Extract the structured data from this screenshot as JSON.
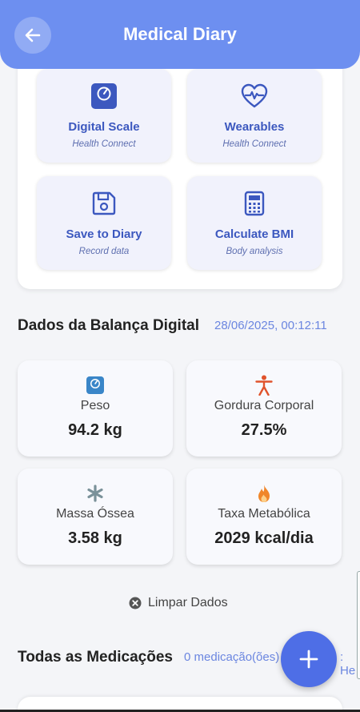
{
  "header": {
    "title": "Medical Diary"
  },
  "actions": [
    {
      "title": "Digital Scale",
      "subtitle": "Health Connect",
      "icon": "scale-icon"
    },
    {
      "title": "Wearables",
      "subtitle": "Health Connect",
      "icon": "heart-pulse-icon"
    },
    {
      "title": "Save to Diary",
      "subtitle": "Record data",
      "icon": "save-icon"
    },
    {
      "title": "Calculate BMI",
      "subtitle": "Body analysis",
      "icon": "calculator-icon"
    }
  ],
  "scale_section": {
    "title": "Dados da Balança Digital",
    "timestamp": "28/06/2025, 00:12:11"
  },
  "stats": [
    {
      "label": "Peso",
      "value": "94.2 kg",
      "icon": "scale-icon",
      "color": "#3a86c8"
    },
    {
      "label": "Gordura Corporal",
      "value": "27.5%",
      "icon": "body-icon",
      "color": "#e0532c"
    },
    {
      "label": "Massa Óssea",
      "value": "3.58 kg",
      "icon": "bone-icon",
      "color": "#7a9199"
    },
    {
      "label": "Taxa Metabólica",
      "value": "2029 kcal/dia",
      "icon": "flame-icon",
      "color": "#f0862a"
    }
  ],
  "clear_button": {
    "label": "Limpar Dados"
  },
  "medications": {
    "title": "Todas as Medicações",
    "count": "0 medicação(ões)",
    "peek": ": He"
  },
  "colors": {
    "primary": "#6d8ff0",
    "accent": "#4e6ee6",
    "card_tint": "#f1f2fc"
  }
}
